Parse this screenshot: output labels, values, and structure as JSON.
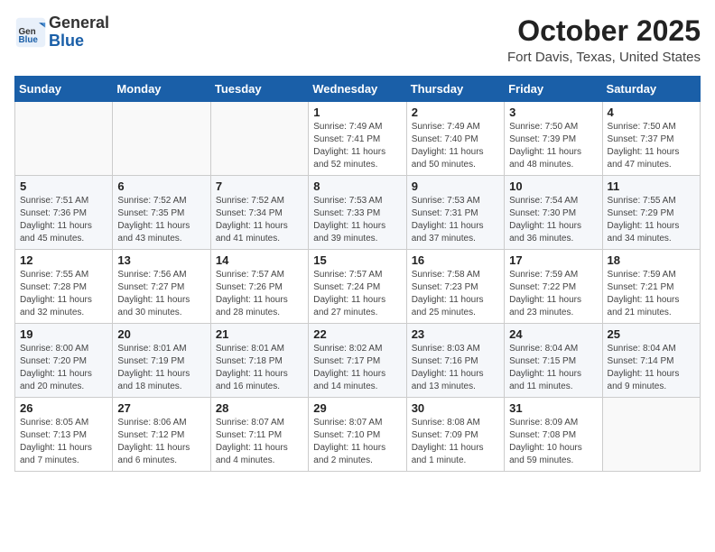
{
  "header": {
    "logo_general": "General",
    "logo_blue": "Blue",
    "month_title": "October 2025",
    "location": "Fort Davis, Texas, United States"
  },
  "days_of_week": [
    "Sunday",
    "Monday",
    "Tuesday",
    "Wednesday",
    "Thursday",
    "Friday",
    "Saturday"
  ],
  "weeks": [
    [
      {
        "day": "",
        "info": ""
      },
      {
        "day": "",
        "info": ""
      },
      {
        "day": "",
        "info": ""
      },
      {
        "day": "1",
        "info": "Sunrise: 7:49 AM\nSunset: 7:41 PM\nDaylight: 11 hours\nand 52 minutes."
      },
      {
        "day": "2",
        "info": "Sunrise: 7:49 AM\nSunset: 7:40 PM\nDaylight: 11 hours\nand 50 minutes."
      },
      {
        "day": "3",
        "info": "Sunrise: 7:50 AM\nSunset: 7:39 PM\nDaylight: 11 hours\nand 48 minutes."
      },
      {
        "day": "4",
        "info": "Sunrise: 7:50 AM\nSunset: 7:37 PM\nDaylight: 11 hours\nand 47 minutes."
      }
    ],
    [
      {
        "day": "5",
        "info": "Sunrise: 7:51 AM\nSunset: 7:36 PM\nDaylight: 11 hours\nand 45 minutes."
      },
      {
        "day": "6",
        "info": "Sunrise: 7:52 AM\nSunset: 7:35 PM\nDaylight: 11 hours\nand 43 minutes."
      },
      {
        "day": "7",
        "info": "Sunrise: 7:52 AM\nSunset: 7:34 PM\nDaylight: 11 hours\nand 41 minutes."
      },
      {
        "day": "8",
        "info": "Sunrise: 7:53 AM\nSunset: 7:33 PM\nDaylight: 11 hours\nand 39 minutes."
      },
      {
        "day": "9",
        "info": "Sunrise: 7:53 AM\nSunset: 7:31 PM\nDaylight: 11 hours\nand 37 minutes."
      },
      {
        "day": "10",
        "info": "Sunrise: 7:54 AM\nSunset: 7:30 PM\nDaylight: 11 hours\nand 36 minutes."
      },
      {
        "day": "11",
        "info": "Sunrise: 7:55 AM\nSunset: 7:29 PM\nDaylight: 11 hours\nand 34 minutes."
      }
    ],
    [
      {
        "day": "12",
        "info": "Sunrise: 7:55 AM\nSunset: 7:28 PM\nDaylight: 11 hours\nand 32 minutes."
      },
      {
        "day": "13",
        "info": "Sunrise: 7:56 AM\nSunset: 7:27 PM\nDaylight: 11 hours\nand 30 minutes."
      },
      {
        "day": "14",
        "info": "Sunrise: 7:57 AM\nSunset: 7:26 PM\nDaylight: 11 hours\nand 28 minutes."
      },
      {
        "day": "15",
        "info": "Sunrise: 7:57 AM\nSunset: 7:24 PM\nDaylight: 11 hours\nand 27 minutes."
      },
      {
        "day": "16",
        "info": "Sunrise: 7:58 AM\nSunset: 7:23 PM\nDaylight: 11 hours\nand 25 minutes."
      },
      {
        "day": "17",
        "info": "Sunrise: 7:59 AM\nSunset: 7:22 PM\nDaylight: 11 hours\nand 23 minutes."
      },
      {
        "day": "18",
        "info": "Sunrise: 7:59 AM\nSunset: 7:21 PM\nDaylight: 11 hours\nand 21 minutes."
      }
    ],
    [
      {
        "day": "19",
        "info": "Sunrise: 8:00 AM\nSunset: 7:20 PM\nDaylight: 11 hours\nand 20 minutes."
      },
      {
        "day": "20",
        "info": "Sunrise: 8:01 AM\nSunset: 7:19 PM\nDaylight: 11 hours\nand 18 minutes."
      },
      {
        "day": "21",
        "info": "Sunrise: 8:01 AM\nSunset: 7:18 PM\nDaylight: 11 hours\nand 16 minutes."
      },
      {
        "day": "22",
        "info": "Sunrise: 8:02 AM\nSunset: 7:17 PM\nDaylight: 11 hours\nand 14 minutes."
      },
      {
        "day": "23",
        "info": "Sunrise: 8:03 AM\nSunset: 7:16 PM\nDaylight: 11 hours\nand 13 minutes."
      },
      {
        "day": "24",
        "info": "Sunrise: 8:04 AM\nSunset: 7:15 PM\nDaylight: 11 hours\nand 11 minutes."
      },
      {
        "day": "25",
        "info": "Sunrise: 8:04 AM\nSunset: 7:14 PM\nDaylight: 11 hours\nand 9 minutes."
      }
    ],
    [
      {
        "day": "26",
        "info": "Sunrise: 8:05 AM\nSunset: 7:13 PM\nDaylight: 11 hours\nand 7 minutes."
      },
      {
        "day": "27",
        "info": "Sunrise: 8:06 AM\nSunset: 7:12 PM\nDaylight: 11 hours\nand 6 minutes."
      },
      {
        "day": "28",
        "info": "Sunrise: 8:07 AM\nSunset: 7:11 PM\nDaylight: 11 hours\nand 4 minutes."
      },
      {
        "day": "29",
        "info": "Sunrise: 8:07 AM\nSunset: 7:10 PM\nDaylight: 11 hours\nand 2 minutes."
      },
      {
        "day": "30",
        "info": "Sunrise: 8:08 AM\nSunset: 7:09 PM\nDaylight: 11 hours\nand 1 minute."
      },
      {
        "day": "31",
        "info": "Sunrise: 8:09 AM\nSunset: 7:08 PM\nDaylight: 10 hours\nand 59 minutes."
      },
      {
        "day": "",
        "info": ""
      }
    ]
  ]
}
